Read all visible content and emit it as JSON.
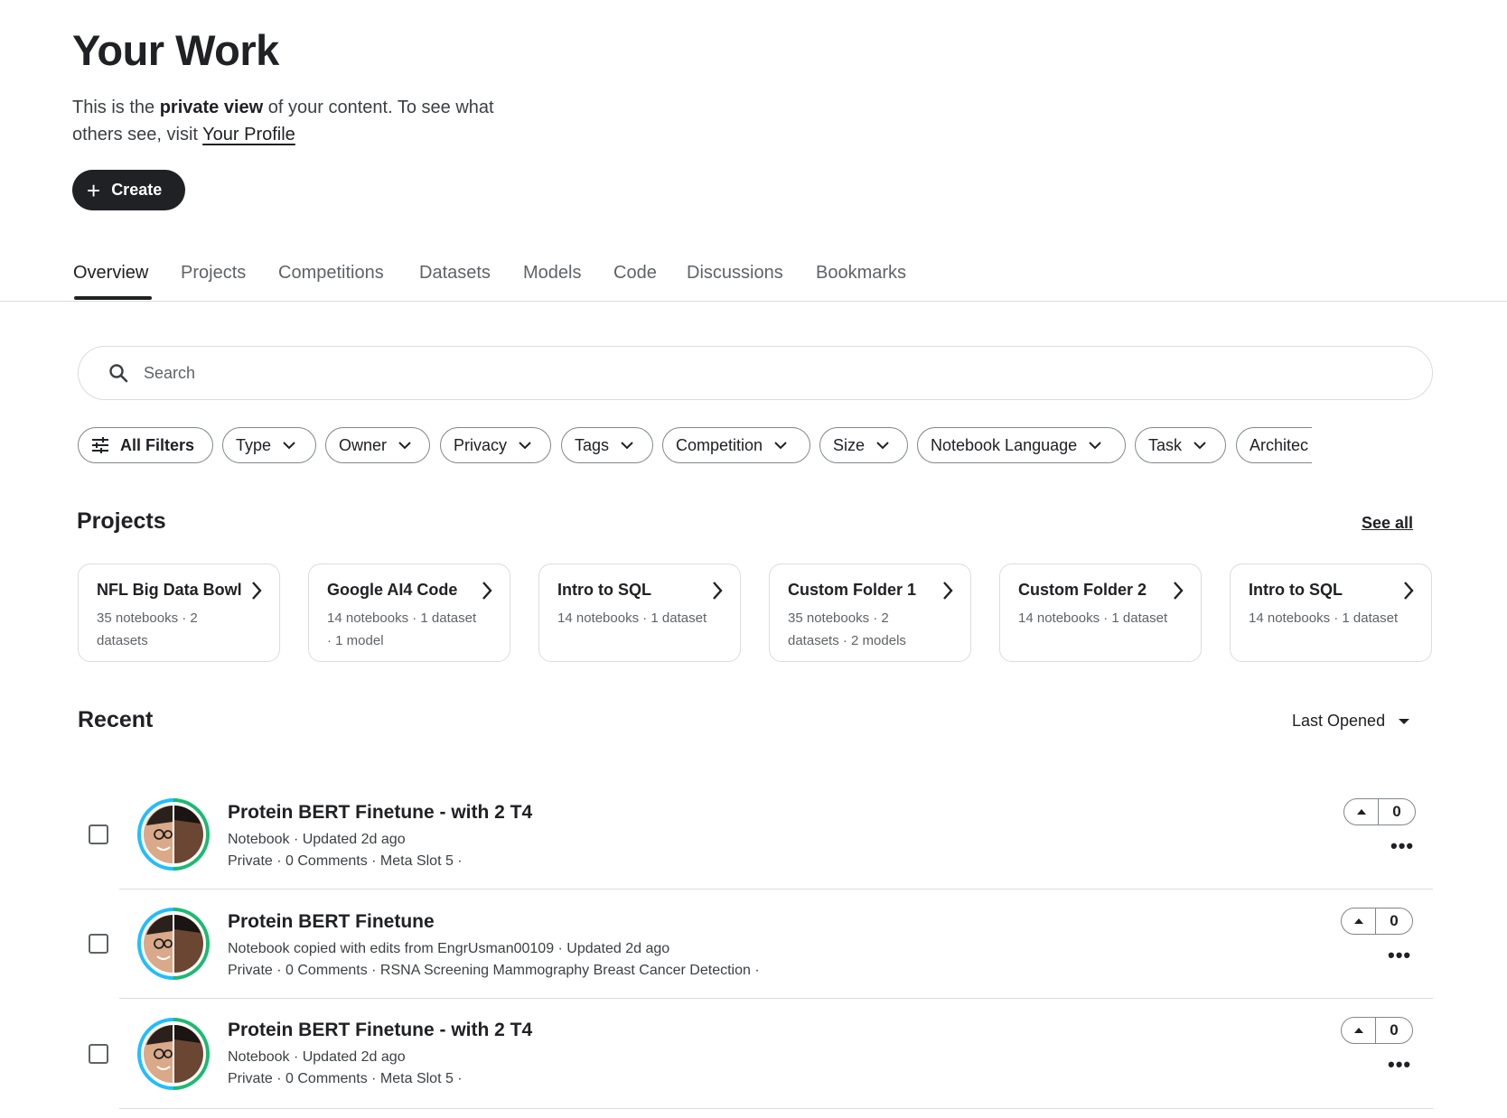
{
  "header": {
    "title": "Your Work",
    "intro_prefix": "This is the ",
    "intro_bold": "private view",
    "intro_middle": " of your content. To see what others see, visit ",
    "profile_link": "Your Profile",
    "create_label": "Create"
  },
  "tabs": [
    {
      "label": "Overview",
      "active": true
    },
    {
      "label": "Projects"
    },
    {
      "label": "Competitions"
    },
    {
      "label": "Datasets"
    },
    {
      "label": "Models"
    },
    {
      "label": "Code"
    },
    {
      "label": "Discussions"
    },
    {
      "label": "Bookmarks"
    }
  ],
  "search": {
    "placeholder": "Search"
  },
  "filters": [
    "All Filters",
    "Type",
    "Owner",
    "Privacy",
    "Tags",
    "Competition",
    "Size",
    "Notebook Language",
    "Task",
    "Architec"
  ],
  "projects": {
    "title": "Projects",
    "see_all": "See all",
    "cards": [
      {
        "title": "NFL Big Data Bowl",
        "meta": "35 notebooks · 2 datasets"
      },
      {
        "title": "Google AI4 Code",
        "meta": "14 notebooks · 1 dataset · 1 model"
      },
      {
        "title": "Intro to SQL",
        "meta": "14 notebooks · 1 dataset"
      },
      {
        "title": "Custom Folder 1",
        "meta": "35 notebooks · 2 datasets  · 2 models"
      },
      {
        "title": "Custom Folder 2",
        "meta": "14 notebooks · 1 dataset"
      },
      {
        "title": "Intro to SQL",
        "meta": "14 notebooks · 1 dataset"
      }
    ]
  },
  "recent": {
    "title": "Recent",
    "sort_label": "Last Opened",
    "items": [
      {
        "title": "Protein BERT Finetune - with 2 T4",
        "subtitle": "Notebook · Updated 2d ago",
        "meta": "Private · 0 Comments · Meta Slot 5 ·",
        "votes": "0"
      },
      {
        "title": "Protein BERT Finetune",
        "subtitle": "Notebook copied with edits from EngrUsman00109 · Updated 2d ago",
        "meta": "Private · 0 Comments · RSNA Screening Mammography Breast Cancer Detection ·",
        "votes": "0"
      },
      {
        "title": "Protein BERT Finetune - with 2 T4",
        "subtitle": "Notebook · Updated 2d ago",
        "meta": "Private · 0 Comments · Meta Slot 5 ·",
        "votes": "0"
      }
    ]
  },
  "colors": {
    "primary": "#202124",
    "border": "#dadce0",
    "avatar_ring_blue": "#20beff",
    "avatar_ring_green": "#1eb971"
  },
  "icons": [
    "plus-icon",
    "search-icon",
    "filter-sliders-icon",
    "chevron-down-icon",
    "chevron-right-icon",
    "caret-down-icon",
    "upvote-icon",
    "more-icon"
  ]
}
